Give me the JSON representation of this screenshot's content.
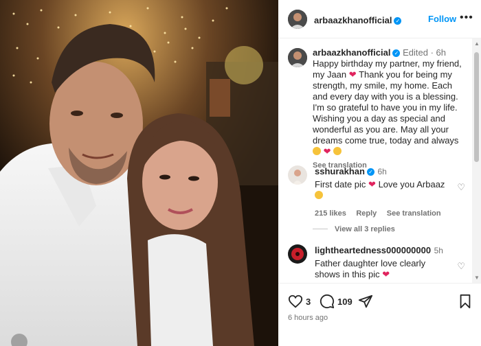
{
  "post": {
    "author": "arbaazkhanofficial",
    "follow_label": "Follow",
    "more_label": "•••",
    "caption": {
      "author": "arbaazkhanofficial",
      "edited": "Edited",
      "age": "6h",
      "text_1": "Happy birthday my partner, my friend, my Jaan",
      "text_2": "Thank you for being my strength, my smile, my home. Each and every day with you is a blessing. I'm so grateful to have you in my life. Wishing you a day as special and wonderful as you are. May all your dreams come true, today and always",
      "see_translation": "See translation"
    },
    "comments": [
      {
        "author": "sshurakhan",
        "age": "6h",
        "text_1": "First date pic",
        "text_2": "Love you Arbaaz",
        "likes": "215 likes",
        "reply": "Reply",
        "see_translation": "See translation",
        "view_replies": "View all 3 replies"
      },
      {
        "author": "lightheartedness000000000",
        "age": "5h",
        "text": "Father daughter love clearly shows in this pic"
      }
    ],
    "actions": {
      "likes_count": "3",
      "comments_count": "109",
      "time_ago": "6 hours ago"
    }
  },
  "icons": {
    "verified": "verified-badge-icon",
    "heart": "heart-icon",
    "comment": "comment-icon",
    "share": "share-icon",
    "save": "bookmark-icon"
  },
  "colors": {
    "accent": "#0095f6",
    "text": "#262626",
    "muted": "#737373",
    "heart_red": "#e0245e"
  }
}
